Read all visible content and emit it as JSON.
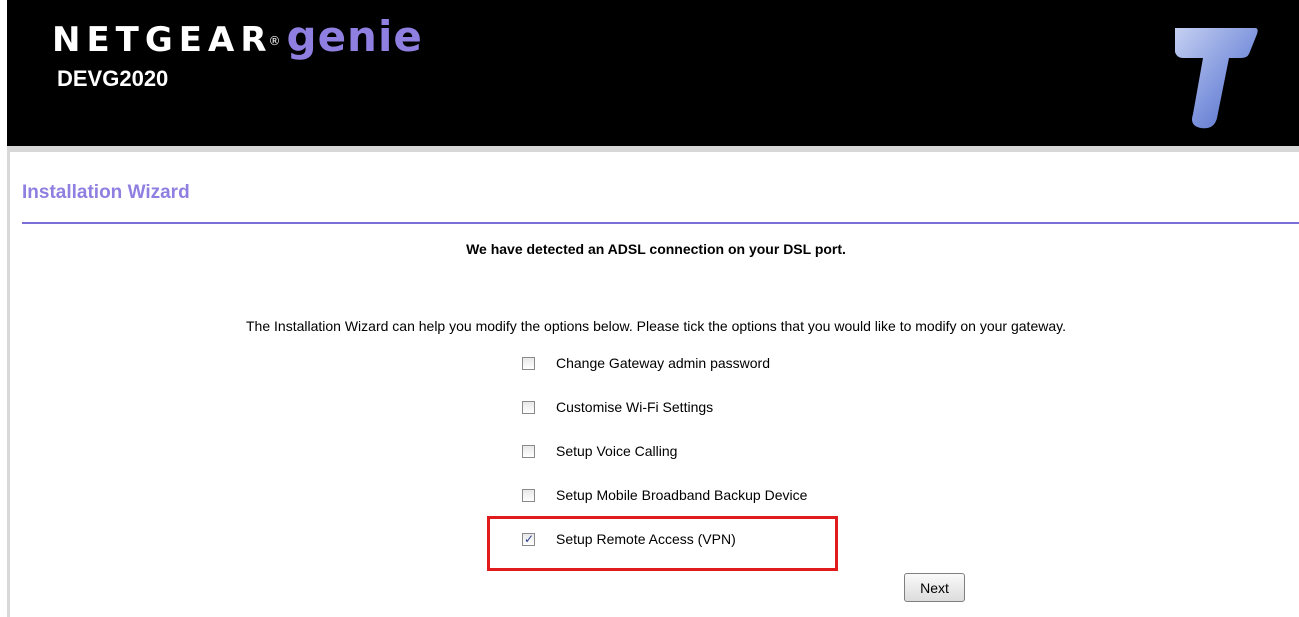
{
  "header": {
    "brand_netgear": "NETGEAR",
    "brand_reg": "®",
    "brand_genie": "genie",
    "model": "DEVG2020",
    "logo_icon": "telstra-t-logo"
  },
  "wizard": {
    "title": "Installation Wizard",
    "detected_message": "We have detected an ADSL connection on your DSL port.",
    "intro": "The Installation Wizard can help you modify the options below.  Please tick the options that you would like to modify on your gateway.",
    "options": [
      {
        "label": "Change Gateway admin password",
        "checked": false
      },
      {
        "label": "Customise Wi-Fi Settings",
        "checked": false
      },
      {
        "label": "Setup Voice Calling",
        "checked": false
      },
      {
        "label": "Setup Mobile Broadband Backup Device",
        "checked": false
      },
      {
        "label": "Setup Remote Access (VPN)",
        "checked": true
      }
    ],
    "next_label": "Next"
  },
  "colors": {
    "accent": "#8f7fe0",
    "rule": "#7a6ed8",
    "highlight": "#e11b1b",
    "header_bg": "#000000"
  }
}
